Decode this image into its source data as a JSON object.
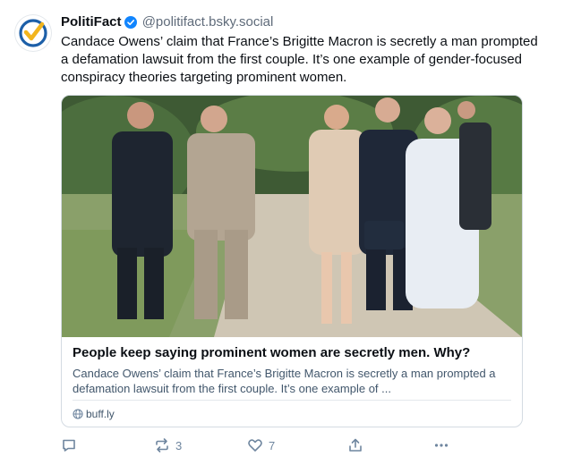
{
  "post": {
    "author_name": "PolitiFact",
    "author_handle": "@politifact.bsky.social",
    "text": "Candace Owens’ claim that France’s Brigitte Macron is secretly a man prompted a defamation lawsuit from the first couple. It’s one example of gender-focused conspiracy theories targeting prominent women."
  },
  "card": {
    "title": "People keep saying prominent women are secretly men. Why?",
    "description": "Candace Owens’ claim that France’s Brigitte Macron is secretly a man prompted a defamation lawsuit from the first couple. It’s one example of ...",
    "domain": "buff.ly"
  },
  "actions": {
    "reply_count": "",
    "repost_count": "3",
    "like_count": "7"
  },
  "colors": {
    "accent": "#1185fe",
    "avatar_check": "#f2b51d",
    "text_muted": "#6f869f"
  }
}
